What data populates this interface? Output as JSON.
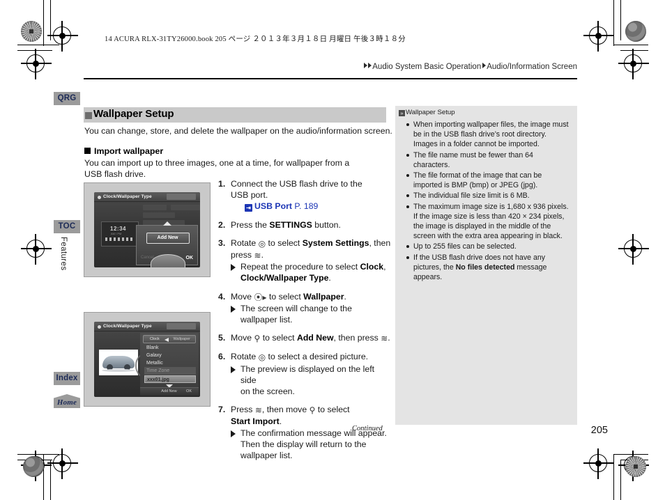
{
  "print_header": "14 ACURA RLX-31TY26000.book   205 ページ   ２０１３年３月１８日   月曜日   午後３時１８分",
  "breadcrumb": {
    "part1": "Audio System Basic Operation",
    "part2": "Audio/Information Screen"
  },
  "tabs": {
    "qrg": "QRG",
    "toc": "TOC",
    "index": "Index",
    "home": "Home",
    "vertical_label": "Features"
  },
  "main": {
    "section_title": "Wallpaper Setup",
    "intro": "You can change, store, and delete the wallpaper on the audio/information screen.",
    "sub_head": "Import wallpaper",
    "sub_text": "You can import up to three images, one at a time, for wallpaper from a USB flash drive.",
    "continued": "Continued",
    "page_number": "205"
  },
  "steps": [
    {
      "num": "1.",
      "text_a": "Connect the USB flash drive to the",
      "text_b": "USB port.",
      "xref_label": "USB Port",
      "xref_page": "P. 189"
    },
    {
      "num": "2.",
      "lead": "Press the ",
      "bold": "SETTINGS",
      "tail": " button."
    },
    {
      "num": "3.",
      "lead": "Rotate ",
      "glyph": "◎",
      "mid": " to select ",
      "bold": "System Settings",
      "tail": ", then press ",
      "glyph2": "≋",
      "end": ".",
      "bullet_lead": "Repeat the procedure to select ",
      "bullet_bold": "Clock",
      "bullet_mid": ",",
      "bullet_bold2": "Clock/Wallpaper Type",
      "bullet_end": "."
    },
    {
      "num": "4.",
      "lead": "Move ",
      "glyph": "⦿▸",
      "mid": " to select ",
      "bold": "Wallpaper",
      "tail": ".",
      "bullet_a": "The screen will change to the",
      "bullet_b": "wallpaper list."
    },
    {
      "num": "5.",
      "lead": "Move ",
      "glyph": "⚲",
      "mid": " to select ",
      "bold": "Add New",
      "tail": ", then press ",
      "glyph2": "≋",
      "end": "."
    },
    {
      "num": "6.",
      "lead": "Rotate ",
      "glyph": "◎",
      "mid": " to select a desired picture.",
      "bullet_a": "The preview is displayed on the left side",
      "bullet_b": "on the screen."
    },
    {
      "num": "7.",
      "lead": "Press ",
      "glyph": "≋",
      "mid": ", then move ",
      "glyph2": "⚲",
      "tail": " to select",
      "bold": "Start Import",
      "end": ".",
      "bullet_a": "The confirmation message will appear.",
      "bullet_b": "Then the display will return to the",
      "bullet_c": "wallpaper list."
    }
  ],
  "notes": {
    "title": "Wallpaper Setup",
    "items": [
      {
        "pre": "When importing wallpaper files, the image must be in the USB flash drive’s root directory. Images in a folder cannot be imported."
      },
      {
        "pre": "The file name must be fewer than 64 characters."
      },
      {
        "pre": "The file format of the image that can be imported is BMP (bmp) or JPEG (jpg)."
      },
      {
        "pre": "The individual file size limit is 6 MB."
      },
      {
        "pre": "The maximum image size is 1,680 x 936 pixels. If the image size is less than 420 × 234 pixels, the image is displayed in the middle of the screen with the extra area appearing in black."
      },
      {
        "pre": "Up to 255 files can be selected."
      },
      {
        "pre": "If the USB flash drive does not have any pictures, the ",
        "bold": "No files detected",
        "post": " message appears."
      }
    ]
  },
  "screenshot1": {
    "title": "Clock/Wallpaper Type",
    "clock_time": "12:34",
    "clock_sub": "AM / PM",
    "button": "Add New",
    "ok": "OK",
    "ghost": "Cancel"
  },
  "screenshot2": {
    "title": "Clock/Wallpaper Type",
    "seg_left": "Clock",
    "seg_right": "Wallpaper",
    "list": [
      "Blank",
      "Galaxy",
      "Metallic",
      "Time Zone",
      "xxx01.jpg"
    ],
    "bottom_left": "Add New",
    "bottom_right": "OK"
  }
}
